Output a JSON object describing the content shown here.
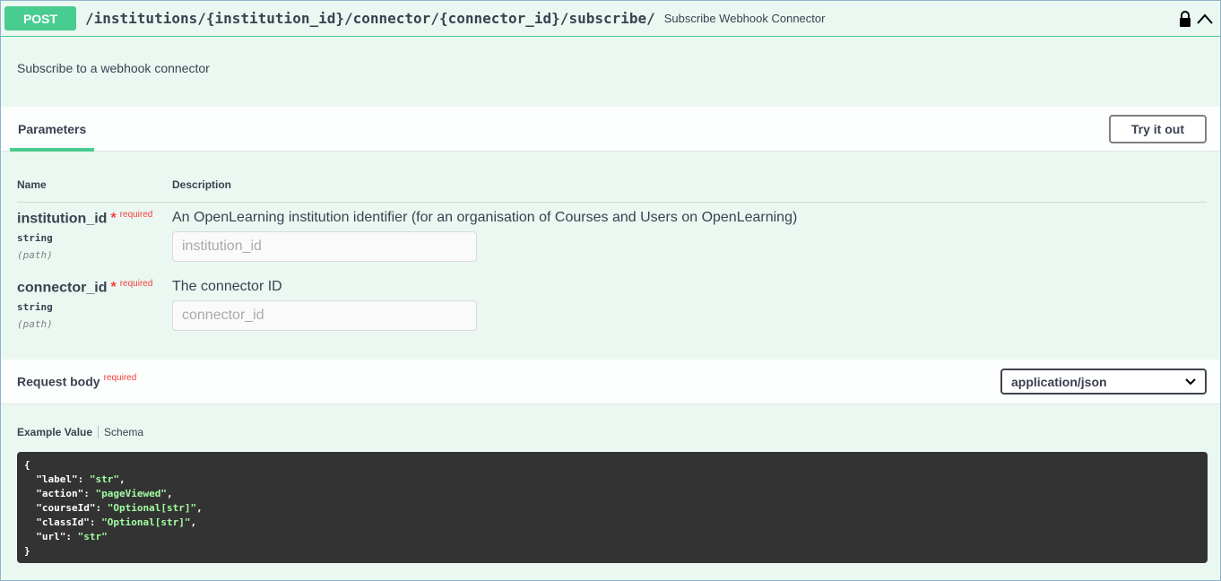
{
  "operation": {
    "method": "POST",
    "path": "/institutions/{institution_id}/connector/{connector_id}/subscribe/",
    "summary": "Subscribe Webhook Connector",
    "description": "Subscribe to a webhook connector"
  },
  "parameters": {
    "tab_label": "Parameters",
    "try_label": "Try it out",
    "col_name": "Name",
    "col_description": "Description",
    "items": [
      {
        "name": "institution_id",
        "required": "required",
        "type": "string",
        "in": "(path)",
        "description": "An OpenLearning institution identifier (for an organisation of Courses and Users on OpenLearning)",
        "placeholder": "institution_id"
      },
      {
        "name": "connector_id",
        "required": "required",
        "type": "string",
        "in": "(path)",
        "description": "The connector ID",
        "placeholder": "connector_id"
      }
    ]
  },
  "request_body": {
    "label": "Request body",
    "required": "required",
    "content_type": "application/json",
    "example_tab": "Example Value",
    "schema_tab": "Schema",
    "example": [
      {
        "key": "\"label\"",
        "value": "\"str\"",
        "comma": ","
      },
      {
        "key": "\"action\"",
        "value": "\"pageViewed\"",
        "comma": ","
      },
      {
        "key": "\"courseId\"",
        "value": "\"Optional[str]\"",
        "comma": ","
      },
      {
        "key": "\"classId\"",
        "value": "\"Optional[str]\"",
        "comma": ","
      },
      {
        "key": "\"url\"",
        "value": "\"str\"",
        "comma": ""
      }
    ]
  },
  "colors": {
    "post": "#49cc90",
    "background": "#ebf8f1",
    "code_bg": "#333333",
    "code_string": "#a2fca2"
  }
}
